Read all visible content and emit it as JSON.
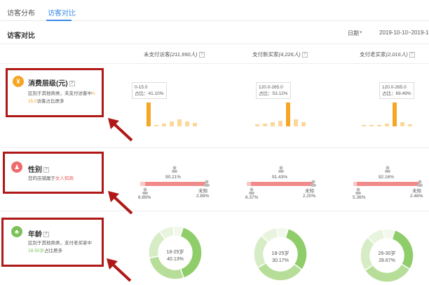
{
  "tabs": [
    {
      "label": "访客分布"
    },
    {
      "label": "访客对比"
    }
  ],
  "section": {
    "title": "访客对比",
    "date_label": "日期",
    "date_range": "2019-10-10~2019-10"
  },
  "columns": [
    {
      "name": "未支付访客",
      "count": "(211,990人)"
    },
    {
      "name": "支付新买家",
      "count": "(4,226人)"
    },
    {
      "name": "支付老买家",
      "count": "(2,016人)"
    }
  ],
  "rows": {
    "spend": {
      "icon_glyph": "¥",
      "title": "消费层级(元)",
      "desc_pre": "区別于其他商类，未支付访客中",
      "desc_hl": "0-15.0",
      "desc_post": "访客占比居多"
    },
    "gender": {
      "icon_glyph": "♟",
      "title": "性别",
      "desc_pre": "您的店铺属于",
      "desc_hl": "女人知商",
      "desc_post": ""
    },
    "age": {
      "icon_glyph": "♣",
      "title": "年龄",
      "desc_pre": "区別于其他商类，支付老买家中",
      "desc_hl": "18-50岁",
      "desc_post": "占比居多"
    }
  },
  "spend_charts": [
    {
      "tip_range": "0-15.0",
      "tip_share": "占比：41.10%",
      "values": [
        41.1,
        3,
        5,
        9,
        12,
        8,
        6
      ],
      "highlight": 0
    },
    {
      "tip_range": "120.0-265.0",
      "tip_share": "占比：53.12%",
      "values": [
        4,
        6,
        9,
        13,
        53.1,
        15,
        10
      ],
      "highlight": 4
    },
    {
      "tip_range": "120.0-265.0",
      "tip_share": "占比：69.49%",
      "values": [
        2,
        3,
        5,
        8,
        69.5,
        12,
        7
      ],
      "highlight": 4
    }
  ],
  "gender_charts": [
    {
      "female_pct": "90.21%",
      "male_pct": "6.89%",
      "unknown_label": "未知",
      "unknown_pct": "2.89%",
      "female": 90.21,
      "male": 6.89,
      "unknown": 2.89
    },
    {
      "female_pct": "91.43%",
      "male_pct": "6.37%",
      "unknown_label": "未知",
      "unknown_pct": "2.20%",
      "female": 91.43,
      "male": 6.37,
      "unknown": 2.2
    },
    {
      "female_pct": "92.16%",
      "male_pct": "5.36%",
      "unknown_label": "未知",
      "unknown_pct": "2.48%",
      "female": 92.16,
      "male": 5.36,
      "unknown": 2.48
    }
  ],
  "age_charts": [
    {
      "label": "18-25岁",
      "pct": "40.13%",
      "share": 40.13
    },
    {
      "label": "18-25岁",
      "pct": "30.17%",
      "share": 30.17
    },
    {
      "label": "26-30岁",
      "pct": "28.67%",
      "share": 28.67
    }
  ],
  "colors": {
    "accent_blue": "#3c89e6",
    "annotation_red": "#b01818",
    "spend_icon": "#f5a623",
    "gender_icon": "#ef6b6b",
    "age_icon": "#7cc15a",
    "bar_highlight": "#f5a623",
    "bar_normal": "#fbd79a",
    "gender_bar": "#f18b8b",
    "donut_main": "#8fcc6a"
  },
  "icons": {
    "help": "question-mark-icon",
    "arrow": "red-arrow-icon",
    "person": "person-icon"
  }
}
